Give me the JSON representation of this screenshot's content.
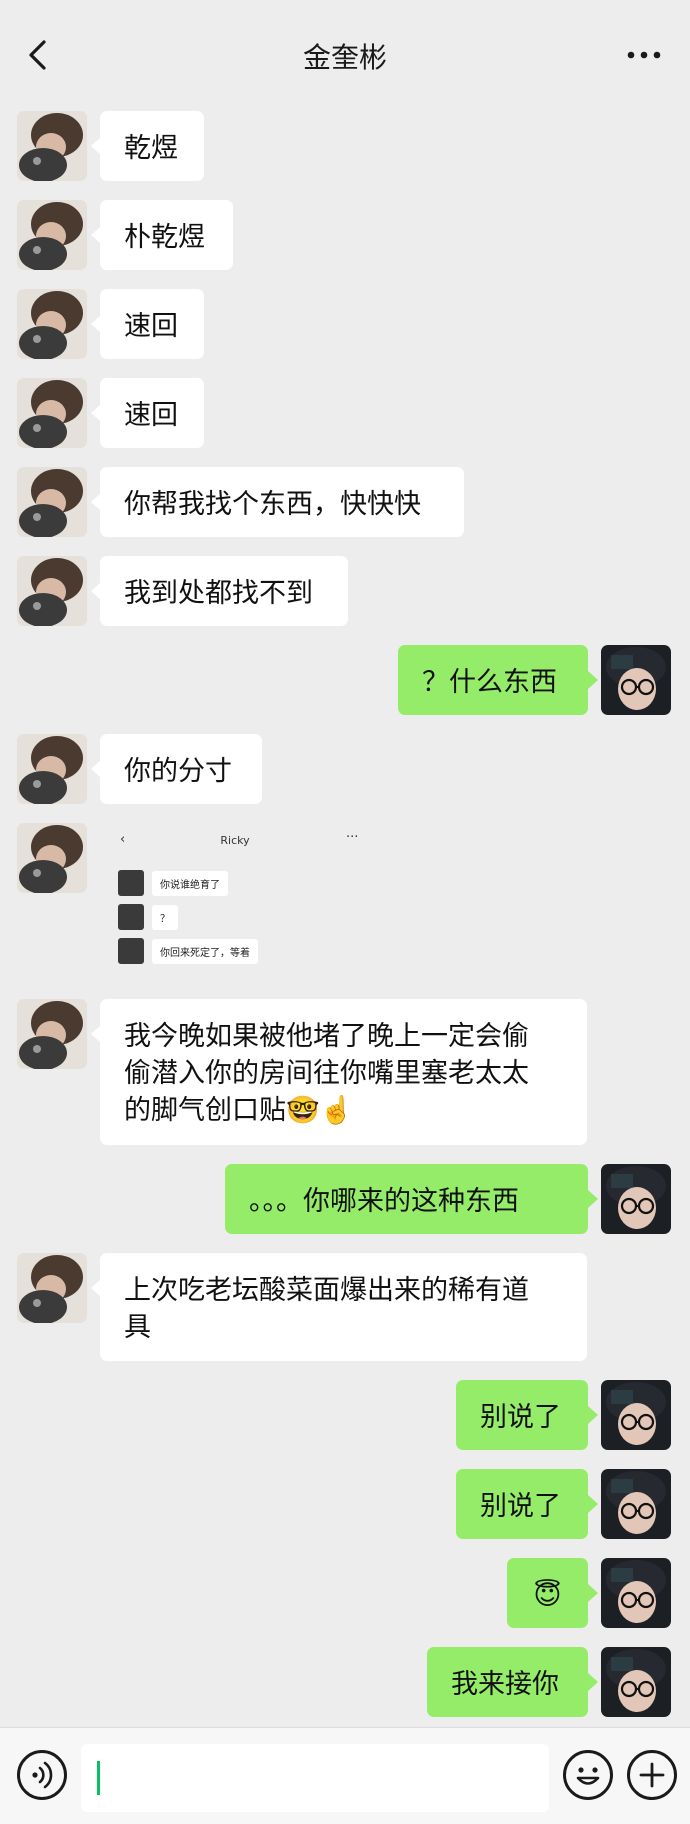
{
  "header": {
    "title": "金奎彬"
  },
  "messages": [
    {
      "side": "in",
      "text": "乾煜"
    },
    {
      "side": "in",
      "text": "朴乾煜"
    },
    {
      "side": "in",
      "text": "速回"
    },
    {
      "side": "in",
      "text": "速回"
    },
    {
      "side": "in",
      "text": "你帮我找个东西，快快快"
    },
    {
      "side": "in",
      "text": "我到处都找不到"
    },
    {
      "side": "out",
      "text": "？什么东西"
    },
    {
      "side": "in",
      "text": "你的分寸"
    },
    {
      "side": "in",
      "type": "image"
    },
    {
      "side": "in",
      "text": "我今晚如果被他堵了晚上一定会偷\n偷潜入你的房间往你嘴里塞老太太\n的脚气创口贴🤓☝️"
    },
    {
      "side": "out",
      "text": "。。。你哪来的这种东西"
    },
    {
      "side": "in",
      "text": "上次吃老坛酸菜面爆出来的稀有道\n具"
    },
    {
      "side": "out",
      "text": "别说了"
    },
    {
      "side": "out",
      "text": "别说了"
    },
    {
      "side": "out",
      "text": "😇"
    },
    {
      "side": "out",
      "text": "我来接你"
    }
  ],
  "screenshot": {
    "title": "Ricky",
    "rows": [
      "你说谁绝育了",
      "？",
      "你回来死定了，等着"
    ]
  },
  "colors": {
    "background": "#ededed",
    "bubble_in": "#ffffff",
    "bubble_out": "#95ec69",
    "cursor": "#07c160"
  },
  "icons": {
    "back": "chevron-left-icon",
    "more": "more-dots-icon",
    "voice": "voice-icon",
    "emoji": "emoji-icon",
    "plus": "plus-icon"
  }
}
